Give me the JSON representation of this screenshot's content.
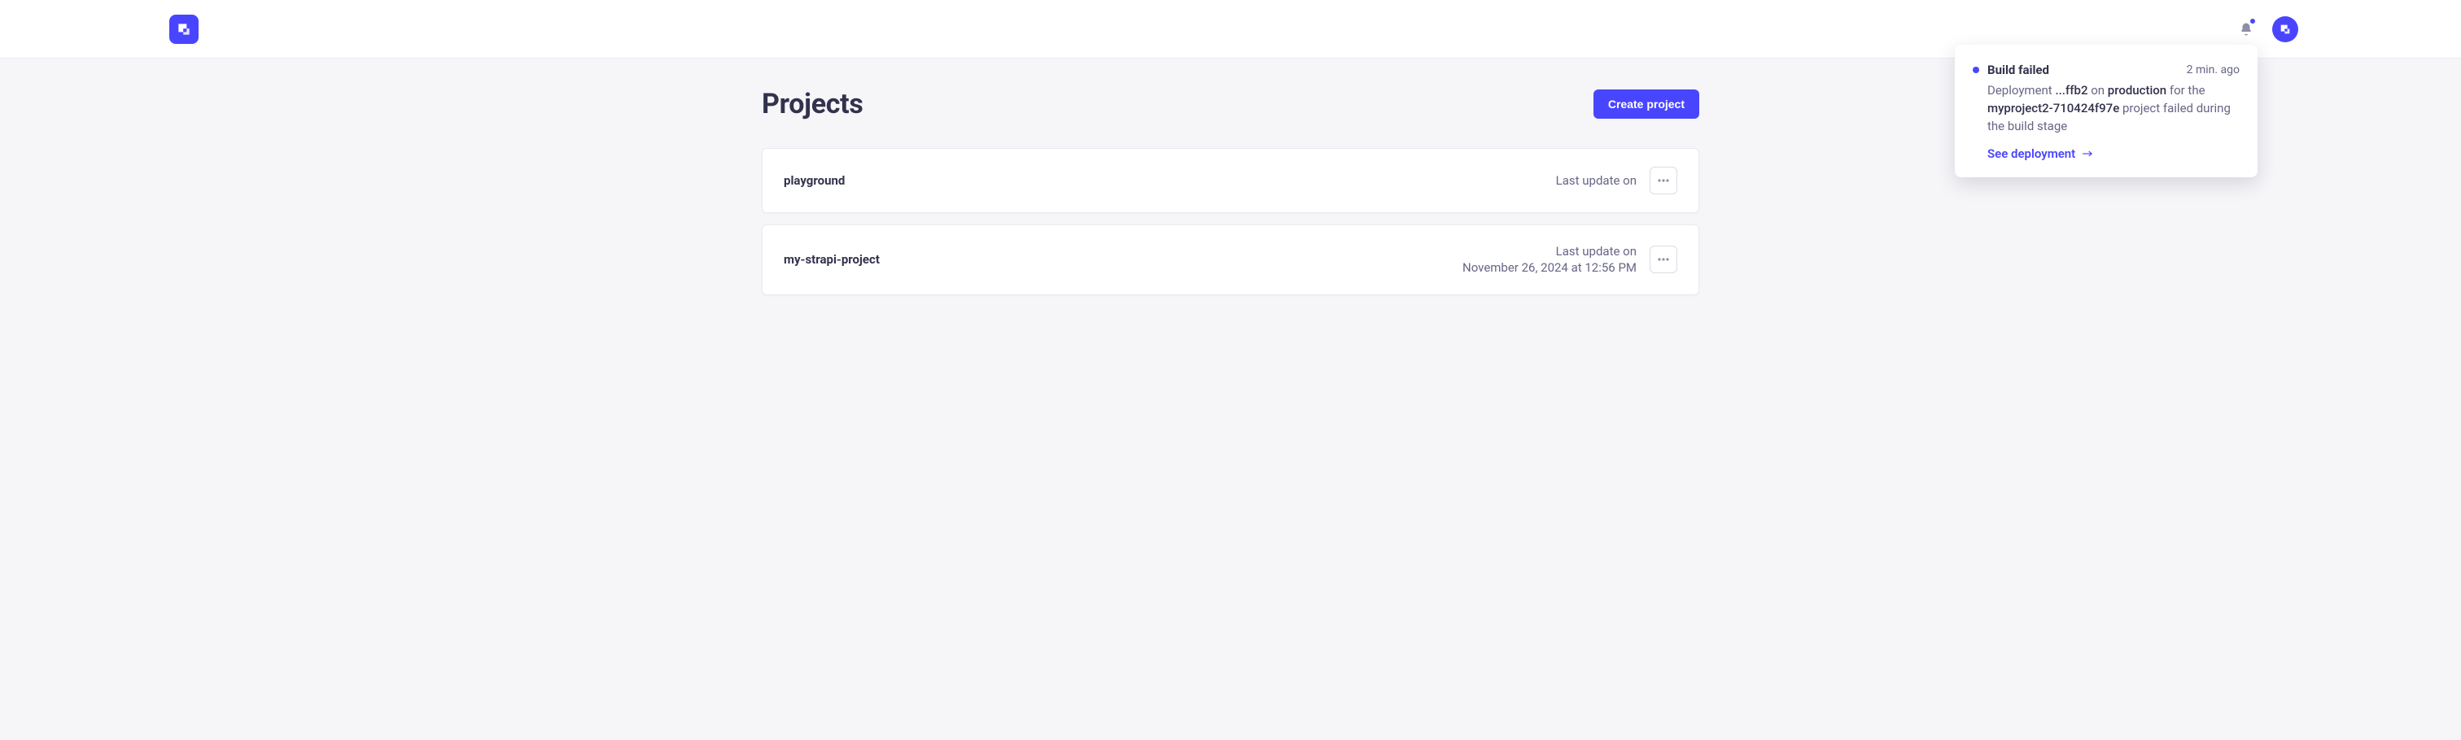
{
  "header": {
    "logo_name": "strapi-logo",
    "bell_name": "bell-icon",
    "create_label": "Create project"
  },
  "page": {
    "title": "Projects"
  },
  "projects": [
    {
      "name": "playground",
      "meta_label": "Last update on",
      "meta_value": ""
    },
    {
      "name": "my-strapi-project",
      "meta_label": "Last update on",
      "meta_value": "November 26, 2024 at 12:56 PM"
    }
  ],
  "notification": {
    "title": "Build failed",
    "time": "2 min. ago",
    "body_prefix": "Deployment ",
    "deployment_id": "...ffb2",
    "body_mid1": " on ",
    "env": "production",
    "body_mid2": " for the ",
    "project_name": "myproject2-710424f97e",
    "body_suffix": " project failed during the build stage",
    "link_label": "See deployment"
  }
}
